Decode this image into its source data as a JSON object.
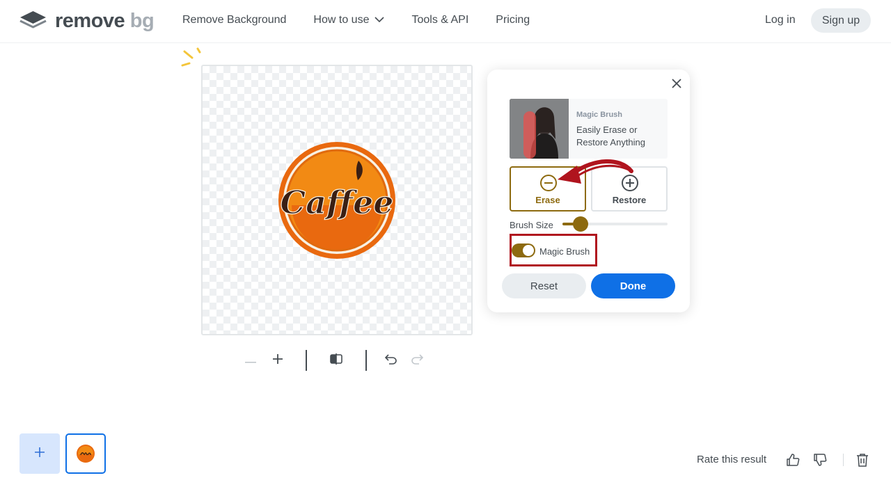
{
  "header": {
    "logo": {
      "word1": "remove",
      "word2": "bg"
    },
    "nav": [
      {
        "label": "Remove Background"
      },
      {
        "label": "How to use"
      },
      {
        "label": "Tools & API"
      },
      {
        "label": "Pricing"
      }
    ],
    "login_label": "Log in",
    "signup_label": "Sign up"
  },
  "canvas": {
    "image_text": "Caffee"
  },
  "panel": {
    "promo_kicker": "Magic Brush",
    "promo_text": "Easily Erase or Restore Anything",
    "erase_label": "Erase",
    "restore_label": "Restore",
    "active_mode": "Erase",
    "brush_size_label": "Brush Size",
    "brush_size_fraction": 0.17,
    "magic_brush_label": "Magic Brush",
    "magic_brush_on": true,
    "reset_label": "Reset",
    "done_label": "Done"
  },
  "footer": {
    "rate_label": "Rate this result"
  },
  "colors": {
    "accent_gold": "#8d6a0f",
    "primary_blue": "#0f70e6",
    "highlight_red": "#b0141e",
    "text": "#454c52"
  },
  "icons": [
    "logo-layers-icon",
    "chevron-down-icon",
    "close-icon",
    "erase-minus-icon",
    "restore-plus-icon",
    "zoom-out-icon",
    "zoom-in-icon",
    "compare-icon",
    "undo-icon",
    "redo-icon",
    "add-icon",
    "thumbs-up-icon",
    "thumbs-down-icon",
    "trash-icon"
  ]
}
